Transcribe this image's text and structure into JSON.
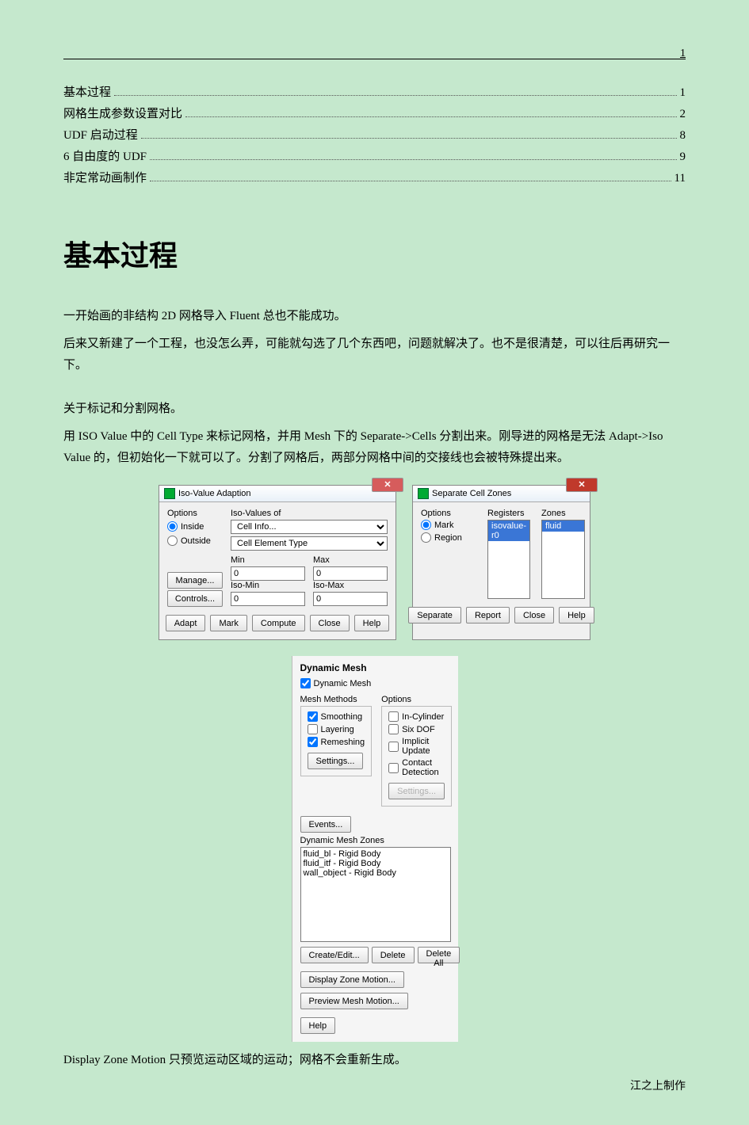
{
  "page_number": "1",
  "toc": [
    {
      "label": "基本过程",
      "page": "1"
    },
    {
      "label": "网格生成参数设置对比",
      "page": "2"
    },
    {
      "label": "UDF 启动过程",
      "page": "8"
    },
    {
      "label": "6 自由度的 UDF",
      "page": "9"
    },
    {
      "label": "非定常动画制作",
      "page": "11"
    }
  ],
  "section_title": "基本过程",
  "para1": "一开始画的非结构 2D 网格导入 Fluent 总也不能成功。",
  "para2": "后来又新建了一个工程，也没怎么弄，可能就勾选了几个东西吧，问题就解决了。也不是很清楚，可以往后再研究一下。",
  "para3": "关于标记和分割网格。",
  "para4": "用 ISO Value 中的 Cell Type 来标记网格，并用 Mesh 下的 Separate->Cells 分割出来。刚导进的网格是无法 Adapt->Iso Value 的，但初始化一下就可以了。分割了网格后，两部分网格中间的交接线也会被特殊提出来。",
  "iso": {
    "title": "Iso-Value Adaption",
    "options_label": "Options",
    "inside": "Inside",
    "outside": "Outside",
    "manage": "Manage...",
    "controls": "Controls...",
    "iso_values_of": "Iso-Values of",
    "combo1": "Cell Info...",
    "combo2": "Cell Element Type",
    "min": "Min",
    "max": "Max",
    "iso_min": "Iso-Min",
    "iso_max": "Iso-Max",
    "val0": "0",
    "buttons": {
      "adapt": "Adapt",
      "mark": "Mark",
      "compute": "Compute",
      "close": "Close",
      "help": "Help"
    }
  },
  "sep": {
    "title": "Separate Cell Zones",
    "options": "Options",
    "mark": "Mark",
    "region": "Region",
    "registers": "Registers",
    "registers_item": "isovalue-r0",
    "zones": "Zones",
    "zones_item": "fluid",
    "buttons": {
      "separate": "Separate",
      "report": "Report",
      "close": "Close",
      "help": "Help"
    }
  },
  "dm": {
    "title": "Dynamic Mesh",
    "enable": "Dynamic Mesh",
    "methods_label": "Mesh Methods",
    "options_label": "Options",
    "smoothing": "Smoothing",
    "layering": "Layering",
    "remeshing": "Remeshing",
    "settings": "Settings...",
    "in_cyl": "In-Cylinder",
    "six_dof": "Six DOF",
    "implicit": "Implicit Update",
    "contact": "Contact Detection",
    "events": "Events...",
    "zones_label": "Dynamic Mesh Zones",
    "zone1": "fluid_bl - Rigid Body",
    "zone2": "fluid_itf - Rigid Body",
    "zone3": "wall_object - Rigid Body",
    "create_edit": "Create/Edit...",
    "delete": "Delete",
    "delete_all": "Delete All",
    "display_zone_motion": "Display Zone Motion...",
    "preview_mesh_motion": "Preview Mesh Motion...",
    "help": "Help"
  },
  "caption_after_dm": "Display Zone Motion 只预览运动区域的运动；网格不会重新生成。",
  "footer": "江之上制作"
}
